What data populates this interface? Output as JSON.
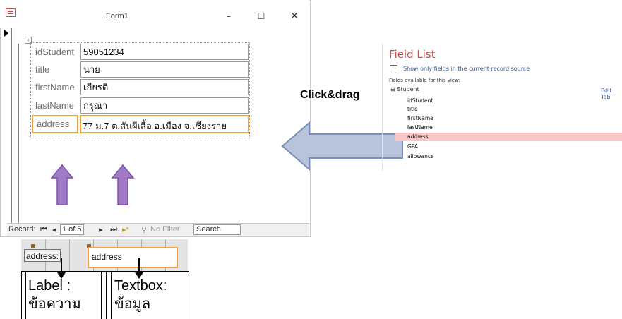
{
  "window": {
    "title": "Form1",
    "minimize": "–",
    "maximize": "☐",
    "close": "✕"
  },
  "form": {
    "fields": [
      {
        "label": "idStudent",
        "value": "59051234"
      },
      {
        "label": "title",
        "value": "นาย"
      },
      {
        "label": "firstName",
        "value": "เกียรติ"
      },
      {
        "label": "lastName",
        "value": "กรุณา"
      },
      {
        "label": "address",
        "value": "77 ม.7 ต.สันผีเสื้อ อ.เมือง จ.เชียงราย"
      }
    ]
  },
  "nav": {
    "record_label": "Record:",
    "record_of": "1 of 5",
    "filter": "No Filter",
    "search": "Search"
  },
  "annotation": {
    "click_drag": "Click&drag"
  },
  "field_list": {
    "title": "Field List",
    "show_only": "Show only fields in the current record source",
    "available": "Fields available for this view:",
    "table": "Student",
    "edit_table": "Edit Tab",
    "fields": [
      "idStudent",
      "title",
      "firstName",
      "lastName",
      "address",
      "GPA",
      "allowance"
    ],
    "highlighted": "address"
  },
  "design": {
    "label_text": "address:",
    "textbox_text": "address",
    "label_caption_1": "Label :",
    "label_caption_2": "ข้อความ",
    "textbox_caption_1": "Textbox:",
    "textbox_caption_2": "ข้อมูล"
  },
  "colors": {
    "highlight_orange": "#f0a040",
    "arrow_purple": "#a07ac6",
    "arrow_blue": "#b8c4dc",
    "field_list_highlight": "#f8c7c7"
  }
}
